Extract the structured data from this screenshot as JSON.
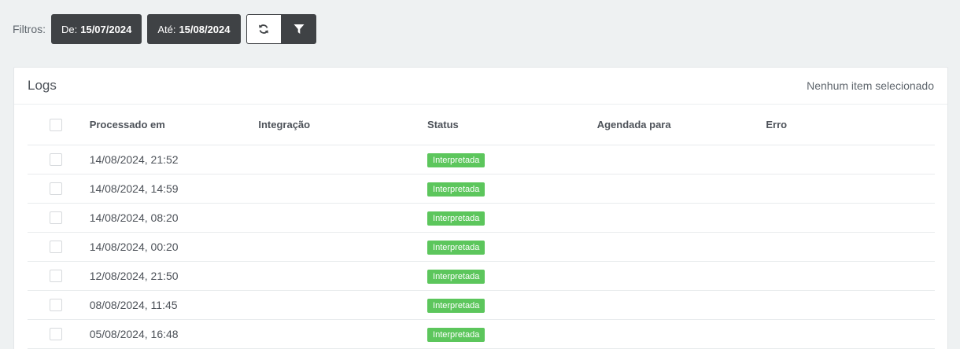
{
  "filters": {
    "label": "Filtros:",
    "from_label": "De:",
    "from_value": "15/07/2024",
    "to_label": "Até:",
    "to_value": "15/08/2024",
    "refresh_icon": "refresh-icon",
    "filter_icon": "funnel-icon"
  },
  "logs": {
    "title": "Logs",
    "selection_status": "Nenhum item selecionado",
    "columns": [
      "Processado em",
      "Integração",
      "Status",
      "Agendada para",
      "Erro"
    ],
    "rows": [
      {
        "processed_at": "14/08/2024, 21:52",
        "integration": "",
        "status": "Interpretada",
        "scheduled_for": "",
        "error": ""
      },
      {
        "processed_at": "14/08/2024, 14:59",
        "integration": "",
        "status": "Interpretada",
        "scheduled_for": "",
        "error": ""
      },
      {
        "processed_at": "14/08/2024, 08:20",
        "integration": "",
        "status": "Interpretada",
        "scheduled_for": "",
        "error": ""
      },
      {
        "processed_at": "14/08/2024, 00:20",
        "integration": "",
        "status": "Interpretada",
        "scheduled_for": "",
        "error": ""
      },
      {
        "processed_at": "12/08/2024, 21:50",
        "integration": "",
        "status": "Interpretada",
        "scheduled_for": "",
        "error": ""
      },
      {
        "processed_at": "08/08/2024, 11:45",
        "integration": "",
        "status": "Interpretada",
        "scheduled_for": "",
        "error": ""
      },
      {
        "processed_at": "05/08/2024, 16:48",
        "integration": "",
        "status": "Interpretada",
        "scheduled_for": "",
        "error": ""
      }
    ]
  },
  "colors": {
    "dark_button": "#3f4245",
    "status_success": "#5cc65c",
    "page_background": "#eef1f2"
  }
}
